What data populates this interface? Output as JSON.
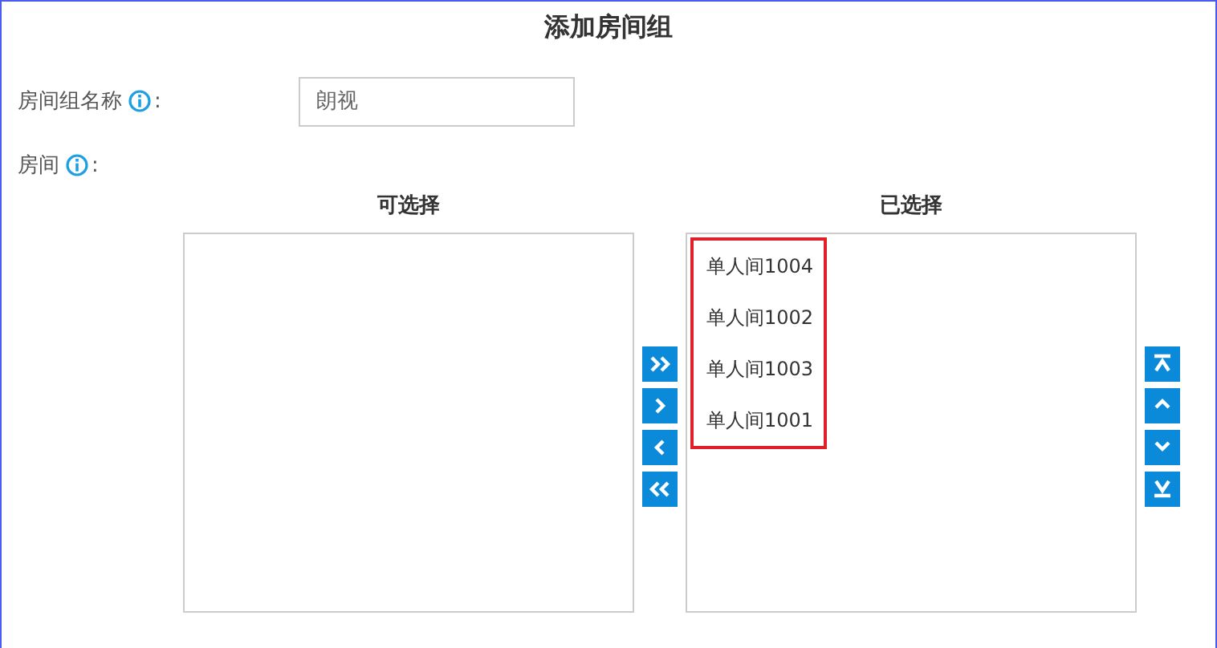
{
  "title": "添加房间组",
  "fields": [
    {
      "label": "房间组名称",
      "info": true,
      "colon": ":",
      "value": "朗视"
    },
    {
      "label": "房间",
      "info": true,
      "colon": ":"
    }
  ],
  "available": {
    "heading": "可选择"
  },
  "selected_list": {
    "heading": "已选择",
    "highlighted": true,
    "items": [
      "单人间1004",
      "单人间1002",
      "单人间1003",
      "单人间1001"
    ]
  },
  "move_buttons": [
    {
      "kind": "all-right"
    },
    {
      "kind": "right"
    },
    {
      "kind": "left"
    },
    {
      "kind": "all-left"
    }
  ],
  "order_buttons": [
    {
      "kind": "top"
    },
    {
      "kind": "up"
    },
    {
      "kind": "down"
    },
    {
      "kind": "bottom"
    }
  ]
}
